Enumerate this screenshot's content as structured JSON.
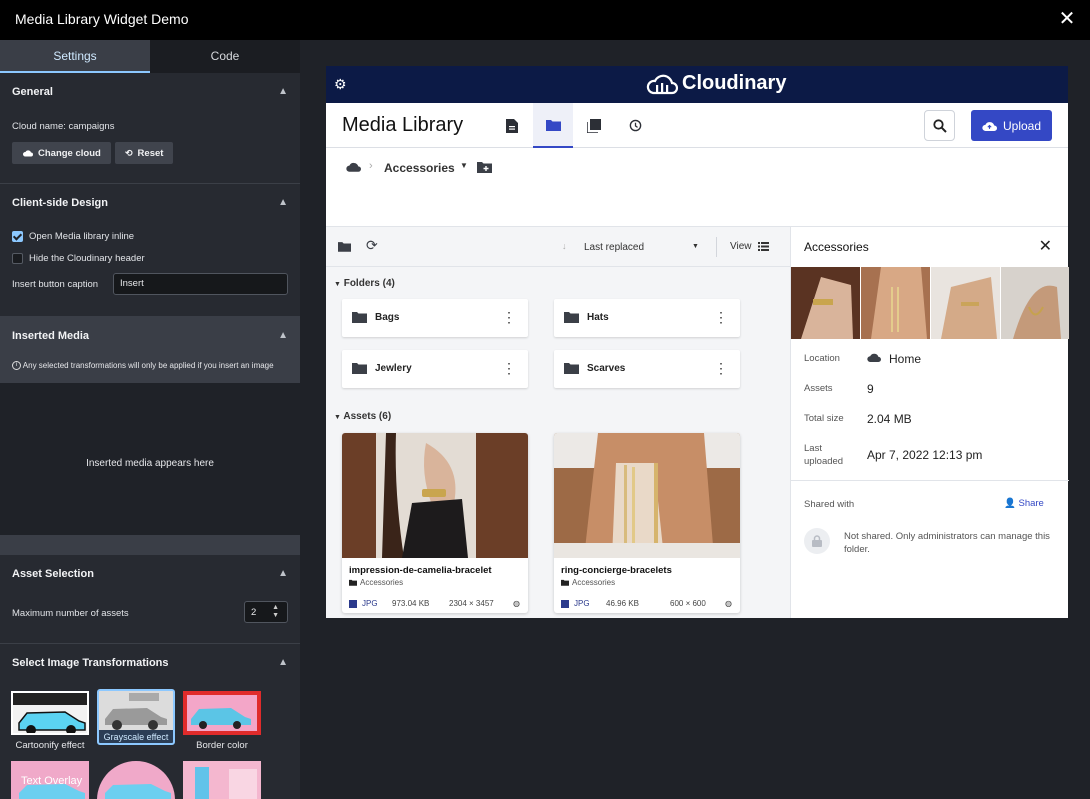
{
  "window": {
    "title": "Media Library Widget Demo",
    "close": "✕"
  },
  "left": {
    "tabs": [
      {
        "label": "Settings"
      },
      {
        "label": "Code"
      }
    ],
    "general": {
      "heading": "General",
      "cloud_name": "Cloud name: campaigns",
      "change_cloud": "Change cloud",
      "reset": "Reset"
    },
    "client_design": {
      "heading": "Client-side Design",
      "open_inline": "Open Media library inline",
      "open_inline_checked": true,
      "hide_header": "Hide the Cloudinary header",
      "hide_header_checked": false,
      "caption_label": "Insert button caption",
      "caption_value": "Insert"
    },
    "inserted": {
      "heading": "Inserted Media",
      "note": "Any selected transformations will only be applied if you insert an image",
      "placeholder": "Inserted media appears here"
    },
    "asset_selection": {
      "heading": "Asset Selection",
      "max_label": "Maximum number of assets",
      "max_value": "2"
    },
    "transformations": {
      "heading": "Select Image Transformations",
      "items": [
        {
          "label": "Cartoonify effect"
        },
        {
          "label": "Grayscale effect"
        },
        {
          "label": "Border color"
        },
        {
          "label": "Text Overlay"
        }
      ]
    }
  },
  "widget": {
    "brand": "Cloudinary",
    "title": "Media Library",
    "upload": "Upload",
    "breadcrumb": {
      "folder": "Accessories"
    },
    "toolbar": {
      "sort": "Last replaced",
      "view": "View"
    },
    "folders_heading": "Folders (4)",
    "folders": [
      {
        "name": "Bags"
      },
      {
        "name": "Hats"
      },
      {
        "name": "Jewlery"
      },
      {
        "name": "Scarves"
      }
    ],
    "assets_heading": "Assets (6)",
    "assets": [
      {
        "name": "impression-de-camelia-bracelet",
        "folder": "Accessories",
        "format": "JPG",
        "size": "973.04 KB",
        "dims": "2304 × 3457"
      },
      {
        "name": "ring-concierge-bracelets",
        "folder": "Accessories",
        "format": "JPG",
        "size": "46.96 KB",
        "dims": "600 × 600"
      }
    ],
    "details": {
      "title": "Accessories",
      "location_label": "Location",
      "location_value": "Home",
      "assets_label": "Assets",
      "assets_value": "9",
      "size_label": "Total size",
      "size_value": "2.04 MB",
      "uploaded_label": "Last uploaded",
      "uploaded_value": "Apr 7, 2022 12:13 pm",
      "shared_label": "Shared with",
      "share_btn": "Share",
      "shared_note": "Not shared. Only administrators can manage this folder."
    }
  },
  "colors": {
    "accent": "#3448c5",
    "brand_bar": "#0c1a46",
    "settings_accent": "#8cc8ff"
  }
}
